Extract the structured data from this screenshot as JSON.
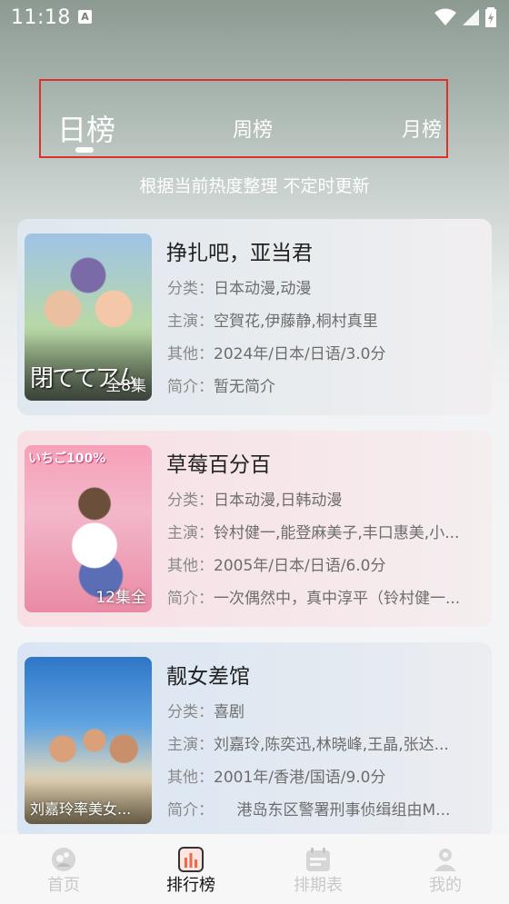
{
  "status": {
    "time": "11:18",
    "notif_icon": "a-icon"
  },
  "tabs": {
    "daily": "日榜",
    "weekly": "周榜",
    "monthly": "月榜",
    "active": "daily"
  },
  "subtitle": "根据当前热度整理 不定时更新",
  "field_labels": {
    "category": "分类：",
    "cast": "主演：",
    "other": "其他：",
    "intro": "简介："
  },
  "items": [
    {
      "title": "挣扎吧，亚当君",
      "badge": "全8集",
      "category": "日本动漫,动漫",
      "cast": "空賀花,伊藤静,桐村真里",
      "other": "2024年/日本/日语/3.0分",
      "intro": "暂无简介"
    },
    {
      "title": "草莓百分百",
      "badge": "12集全",
      "category": "日本动漫,日韩动漫",
      "cast": "铃村健一,能登麻美子,丰口惠美,小...",
      "other": "2005年/日本/日语/6.0分",
      "intro": "一次偶然中，真中淳平（铃村健一..."
    },
    {
      "title": "靓女差馆",
      "badge": "刘嘉玲率美女...",
      "category": "喜剧",
      "cast": "刘嘉玲,陈奕迅,林晓峰,王晶,张达...",
      "other": "2001年/香港/国语/9.0分",
      "intro": "　　港岛东区警署刑事侦缉组由M..."
    }
  ],
  "bottom_nav": [
    {
      "label": "首页",
      "icon": "home-icon",
      "active": false
    },
    {
      "label": "排行榜",
      "icon": "chart-icon",
      "active": true
    },
    {
      "label": "排期表",
      "icon": "calendar-icon",
      "active": false
    },
    {
      "label": "我的",
      "icon": "profile-icon",
      "active": false
    }
  ],
  "colors": {
    "tab_frame": "#e0302a",
    "active_nav_icon": "#f06a4a"
  }
}
